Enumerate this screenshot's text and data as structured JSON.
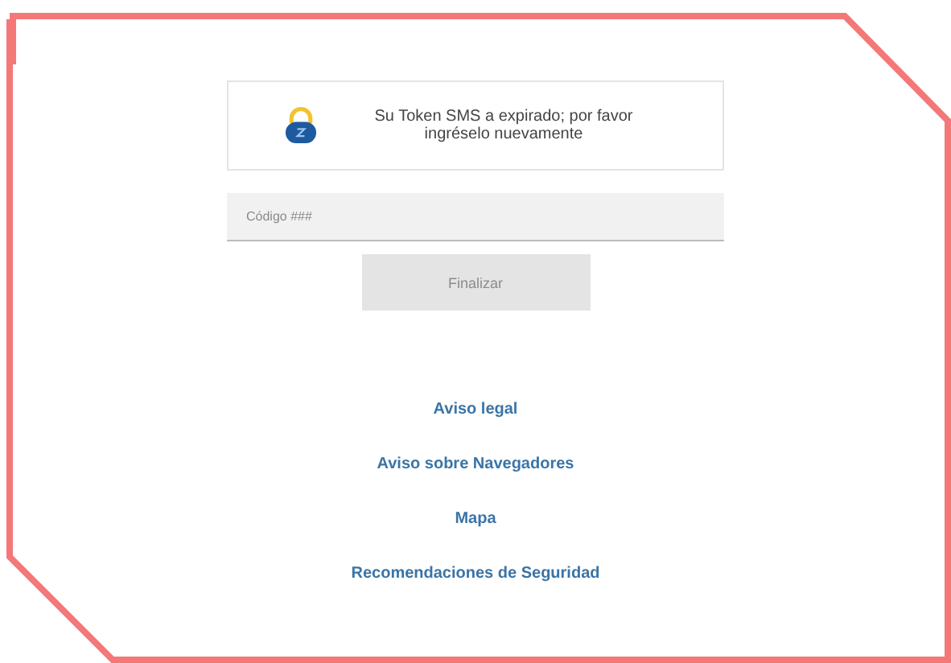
{
  "message": {
    "text": "Su Token SMS a expirado; por favor ingréselo nuevamente"
  },
  "code_field": {
    "placeholder": "Código ###"
  },
  "button": {
    "label": "Finalizar",
    "disabled": true
  },
  "links": [
    "Aviso legal",
    "Aviso sobre Navegadores",
    "Mapa",
    "Recomendaciones de Seguridad"
  ]
}
